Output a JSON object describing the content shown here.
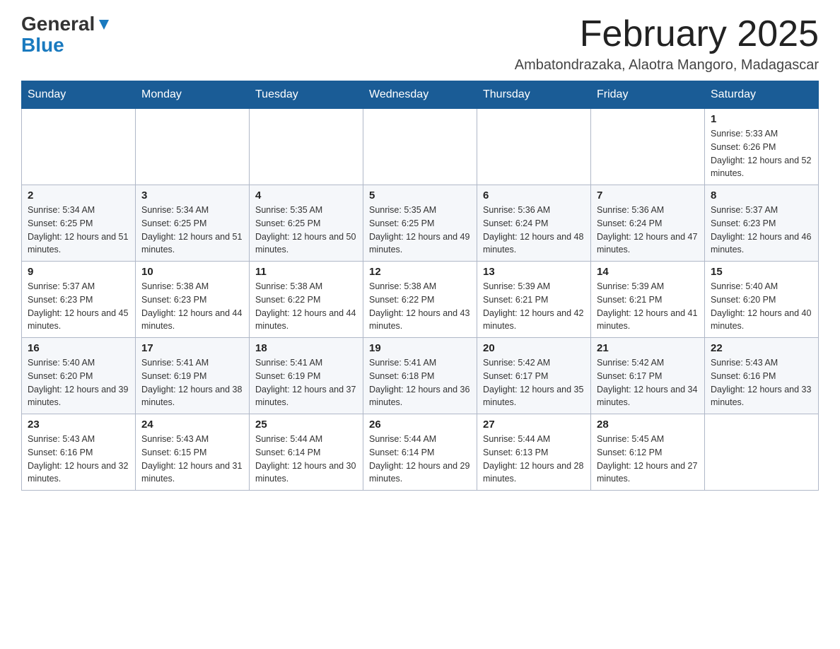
{
  "header": {
    "logo_line1": "General",
    "logo_line2": "Blue",
    "month_title": "February 2025",
    "location": "Ambatondrazaka, Alaotra Mangoro, Madagascar"
  },
  "days_of_week": [
    "Sunday",
    "Monday",
    "Tuesday",
    "Wednesday",
    "Thursday",
    "Friday",
    "Saturday"
  ],
  "weeks": [
    [
      {
        "day": "",
        "info": ""
      },
      {
        "day": "",
        "info": ""
      },
      {
        "day": "",
        "info": ""
      },
      {
        "day": "",
        "info": ""
      },
      {
        "day": "",
        "info": ""
      },
      {
        "day": "",
        "info": ""
      },
      {
        "day": "1",
        "info": "Sunrise: 5:33 AM\nSunset: 6:26 PM\nDaylight: 12 hours and 52 minutes."
      }
    ],
    [
      {
        "day": "2",
        "info": "Sunrise: 5:34 AM\nSunset: 6:25 PM\nDaylight: 12 hours and 51 minutes."
      },
      {
        "day": "3",
        "info": "Sunrise: 5:34 AM\nSunset: 6:25 PM\nDaylight: 12 hours and 51 minutes."
      },
      {
        "day": "4",
        "info": "Sunrise: 5:35 AM\nSunset: 6:25 PM\nDaylight: 12 hours and 50 minutes."
      },
      {
        "day": "5",
        "info": "Sunrise: 5:35 AM\nSunset: 6:25 PM\nDaylight: 12 hours and 49 minutes."
      },
      {
        "day": "6",
        "info": "Sunrise: 5:36 AM\nSunset: 6:24 PM\nDaylight: 12 hours and 48 minutes."
      },
      {
        "day": "7",
        "info": "Sunrise: 5:36 AM\nSunset: 6:24 PM\nDaylight: 12 hours and 47 minutes."
      },
      {
        "day": "8",
        "info": "Sunrise: 5:37 AM\nSunset: 6:23 PM\nDaylight: 12 hours and 46 minutes."
      }
    ],
    [
      {
        "day": "9",
        "info": "Sunrise: 5:37 AM\nSunset: 6:23 PM\nDaylight: 12 hours and 45 minutes."
      },
      {
        "day": "10",
        "info": "Sunrise: 5:38 AM\nSunset: 6:23 PM\nDaylight: 12 hours and 44 minutes."
      },
      {
        "day": "11",
        "info": "Sunrise: 5:38 AM\nSunset: 6:22 PM\nDaylight: 12 hours and 44 minutes."
      },
      {
        "day": "12",
        "info": "Sunrise: 5:38 AM\nSunset: 6:22 PM\nDaylight: 12 hours and 43 minutes."
      },
      {
        "day": "13",
        "info": "Sunrise: 5:39 AM\nSunset: 6:21 PM\nDaylight: 12 hours and 42 minutes."
      },
      {
        "day": "14",
        "info": "Sunrise: 5:39 AM\nSunset: 6:21 PM\nDaylight: 12 hours and 41 minutes."
      },
      {
        "day": "15",
        "info": "Sunrise: 5:40 AM\nSunset: 6:20 PM\nDaylight: 12 hours and 40 minutes."
      }
    ],
    [
      {
        "day": "16",
        "info": "Sunrise: 5:40 AM\nSunset: 6:20 PM\nDaylight: 12 hours and 39 minutes."
      },
      {
        "day": "17",
        "info": "Sunrise: 5:41 AM\nSunset: 6:19 PM\nDaylight: 12 hours and 38 minutes."
      },
      {
        "day": "18",
        "info": "Sunrise: 5:41 AM\nSunset: 6:19 PM\nDaylight: 12 hours and 37 minutes."
      },
      {
        "day": "19",
        "info": "Sunrise: 5:41 AM\nSunset: 6:18 PM\nDaylight: 12 hours and 36 minutes."
      },
      {
        "day": "20",
        "info": "Sunrise: 5:42 AM\nSunset: 6:17 PM\nDaylight: 12 hours and 35 minutes."
      },
      {
        "day": "21",
        "info": "Sunrise: 5:42 AM\nSunset: 6:17 PM\nDaylight: 12 hours and 34 minutes."
      },
      {
        "day": "22",
        "info": "Sunrise: 5:43 AM\nSunset: 6:16 PM\nDaylight: 12 hours and 33 minutes."
      }
    ],
    [
      {
        "day": "23",
        "info": "Sunrise: 5:43 AM\nSunset: 6:16 PM\nDaylight: 12 hours and 32 minutes."
      },
      {
        "day": "24",
        "info": "Sunrise: 5:43 AM\nSunset: 6:15 PM\nDaylight: 12 hours and 31 minutes."
      },
      {
        "day": "25",
        "info": "Sunrise: 5:44 AM\nSunset: 6:14 PM\nDaylight: 12 hours and 30 minutes."
      },
      {
        "day": "26",
        "info": "Sunrise: 5:44 AM\nSunset: 6:14 PM\nDaylight: 12 hours and 29 minutes."
      },
      {
        "day": "27",
        "info": "Sunrise: 5:44 AM\nSunset: 6:13 PM\nDaylight: 12 hours and 28 minutes."
      },
      {
        "day": "28",
        "info": "Sunrise: 5:45 AM\nSunset: 6:12 PM\nDaylight: 12 hours and 27 minutes."
      },
      {
        "day": "",
        "info": ""
      }
    ]
  ]
}
